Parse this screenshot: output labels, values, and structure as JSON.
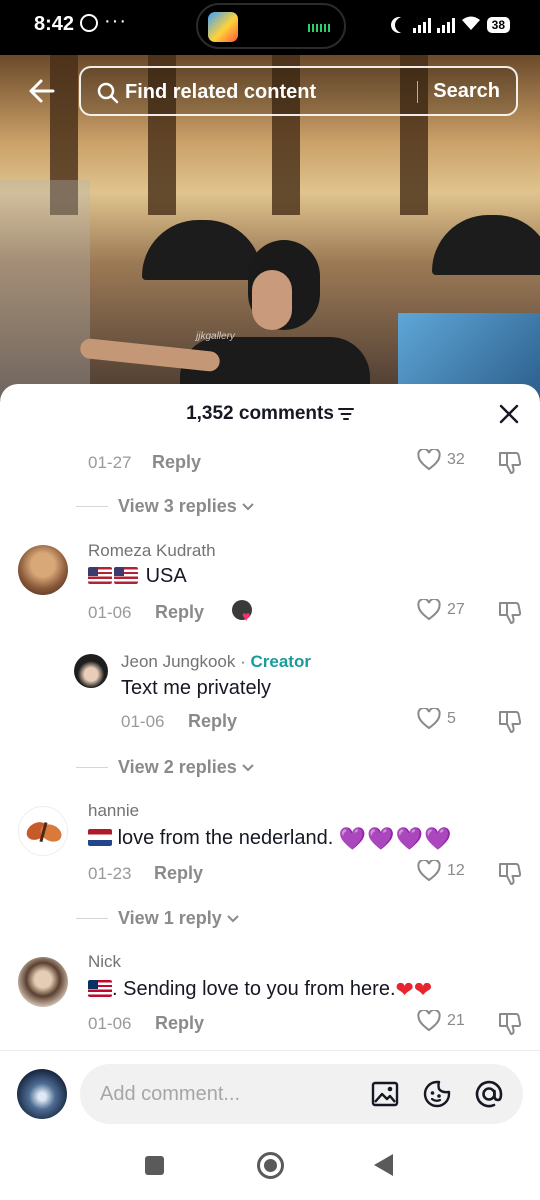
{
  "status_bar": {
    "time": "8:42",
    "battery": "38"
  },
  "search": {
    "placeholder": "Find related content",
    "button": "Search"
  },
  "video": {
    "watermark": "jjkgallery"
  },
  "comments_header": {
    "count_label": "1,352 comments"
  },
  "comments": [
    {
      "date": "01-27",
      "reply_label": "Reply",
      "likes": "32",
      "view_replies": "View 3 replies"
    },
    {
      "username": "Romeza Kudrath",
      "text": "USA",
      "date": "01-06",
      "reply_label": "Reply",
      "likes": "27"
    },
    {
      "username": "Jeon Jungkook",
      "creator_badge": "Creator",
      "text": "Text me privately",
      "date": "01-06",
      "reply_label": "Reply",
      "likes": "5",
      "view_replies": "View 2 replies"
    },
    {
      "username": "hannie",
      "text": "love from the nederland.",
      "date": "01-23",
      "reply_label": "Reply",
      "likes": "12",
      "view_replies": "View 1 reply"
    },
    {
      "username": "Nick",
      "text": ". Sending love to you from here.",
      "date": "01-06",
      "reply_label": "Reply",
      "likes": "21"
    }
  ],
  "compose": {
    "placeholder": "Add comment..."
  },
  "colors": {
    "creator": "#1d9b9b",
    "text": "#161823",
    "muted": "#8a8a8a"
  }
}
